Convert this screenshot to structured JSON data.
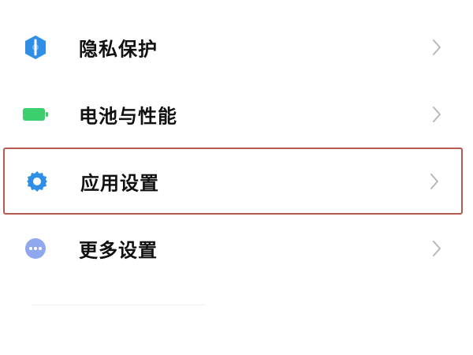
{
  "settings": {
    "items": [
      {
        "label": "隐私保护",
        "icon": "privacy-shield-icon"
      },
      {
        "label": "电池与性能",
        "icon": "battery-icon"
      },
      {
        "label": "应用设置",
        "icon": "gear-icon"
      },
      {
        "label": "更多设置",
        "icon": "more-dots-icon"
      }
    ],
    "highlighted_index": 2
  },
  "colors": {
    "privacy_icon": "#2f8fe6",
    "battery_icon": "#3ccf6e",
    "gear_icon": "#2f8fe6",
    "more_icon": "#8fa8ee",
    "highlight_border": "#b55a4f",
    "chevron": "#b8b8b8",
    "label_text": "#111111"
  }
}
